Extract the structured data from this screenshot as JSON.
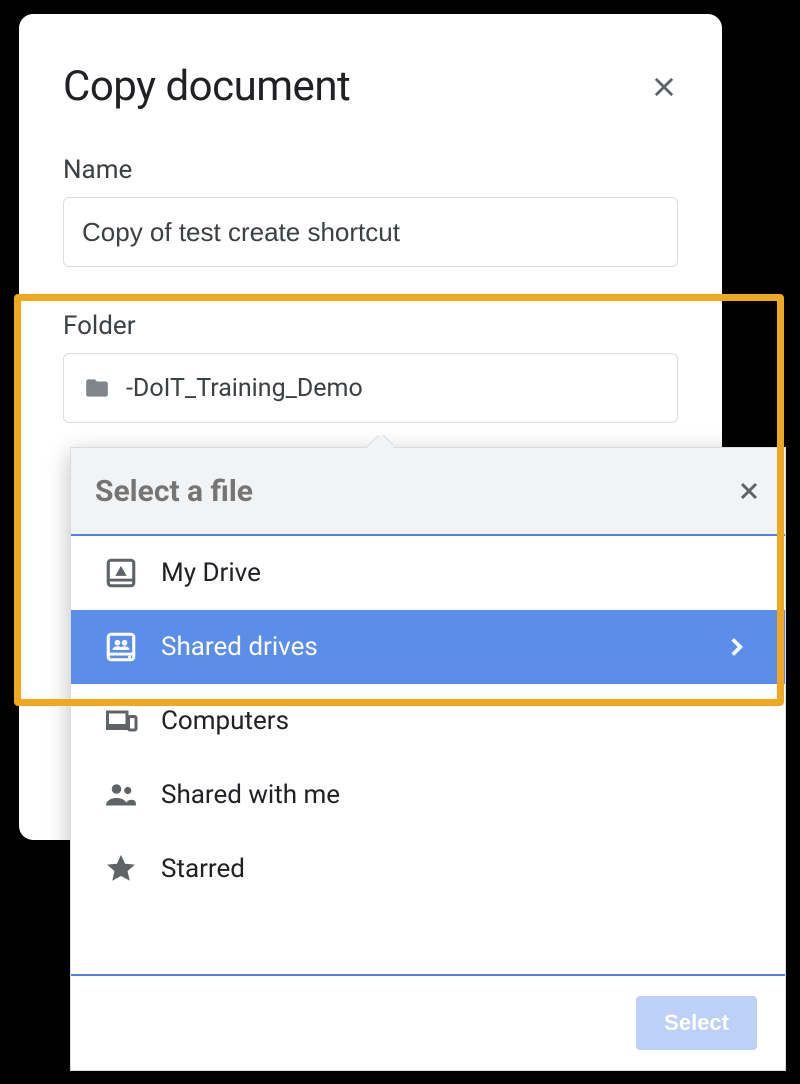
{
  "dialog": {
    "title": "Copy document",
    "name_label": "Name",
    "name_value": "Copy of test create shortcut",
    "folder_label": "Folder",
    "folder_value": "-DoIT_Training_Demo"
  },
  "picker": {
    "title": "Select a file",
    "select_button": "Select",
    "items": [
      {
        "label": "My Drive",
        "icon": "drive",
        "selected": false
      },
      {
        "label": "Shared drives",
        "icon": "shared-drives",
        "selected": true
      },
      {
        "label": "Computers",
        "icon": "computers",
        "selected": false
      },
      {
        "label": "Shared with me",
        "icon": "shared-with-me",
        "selected": false
      },
      {
        "label": "Starred",
        "icon": "star",
        "selected": false
      }
    ]
  }
}
